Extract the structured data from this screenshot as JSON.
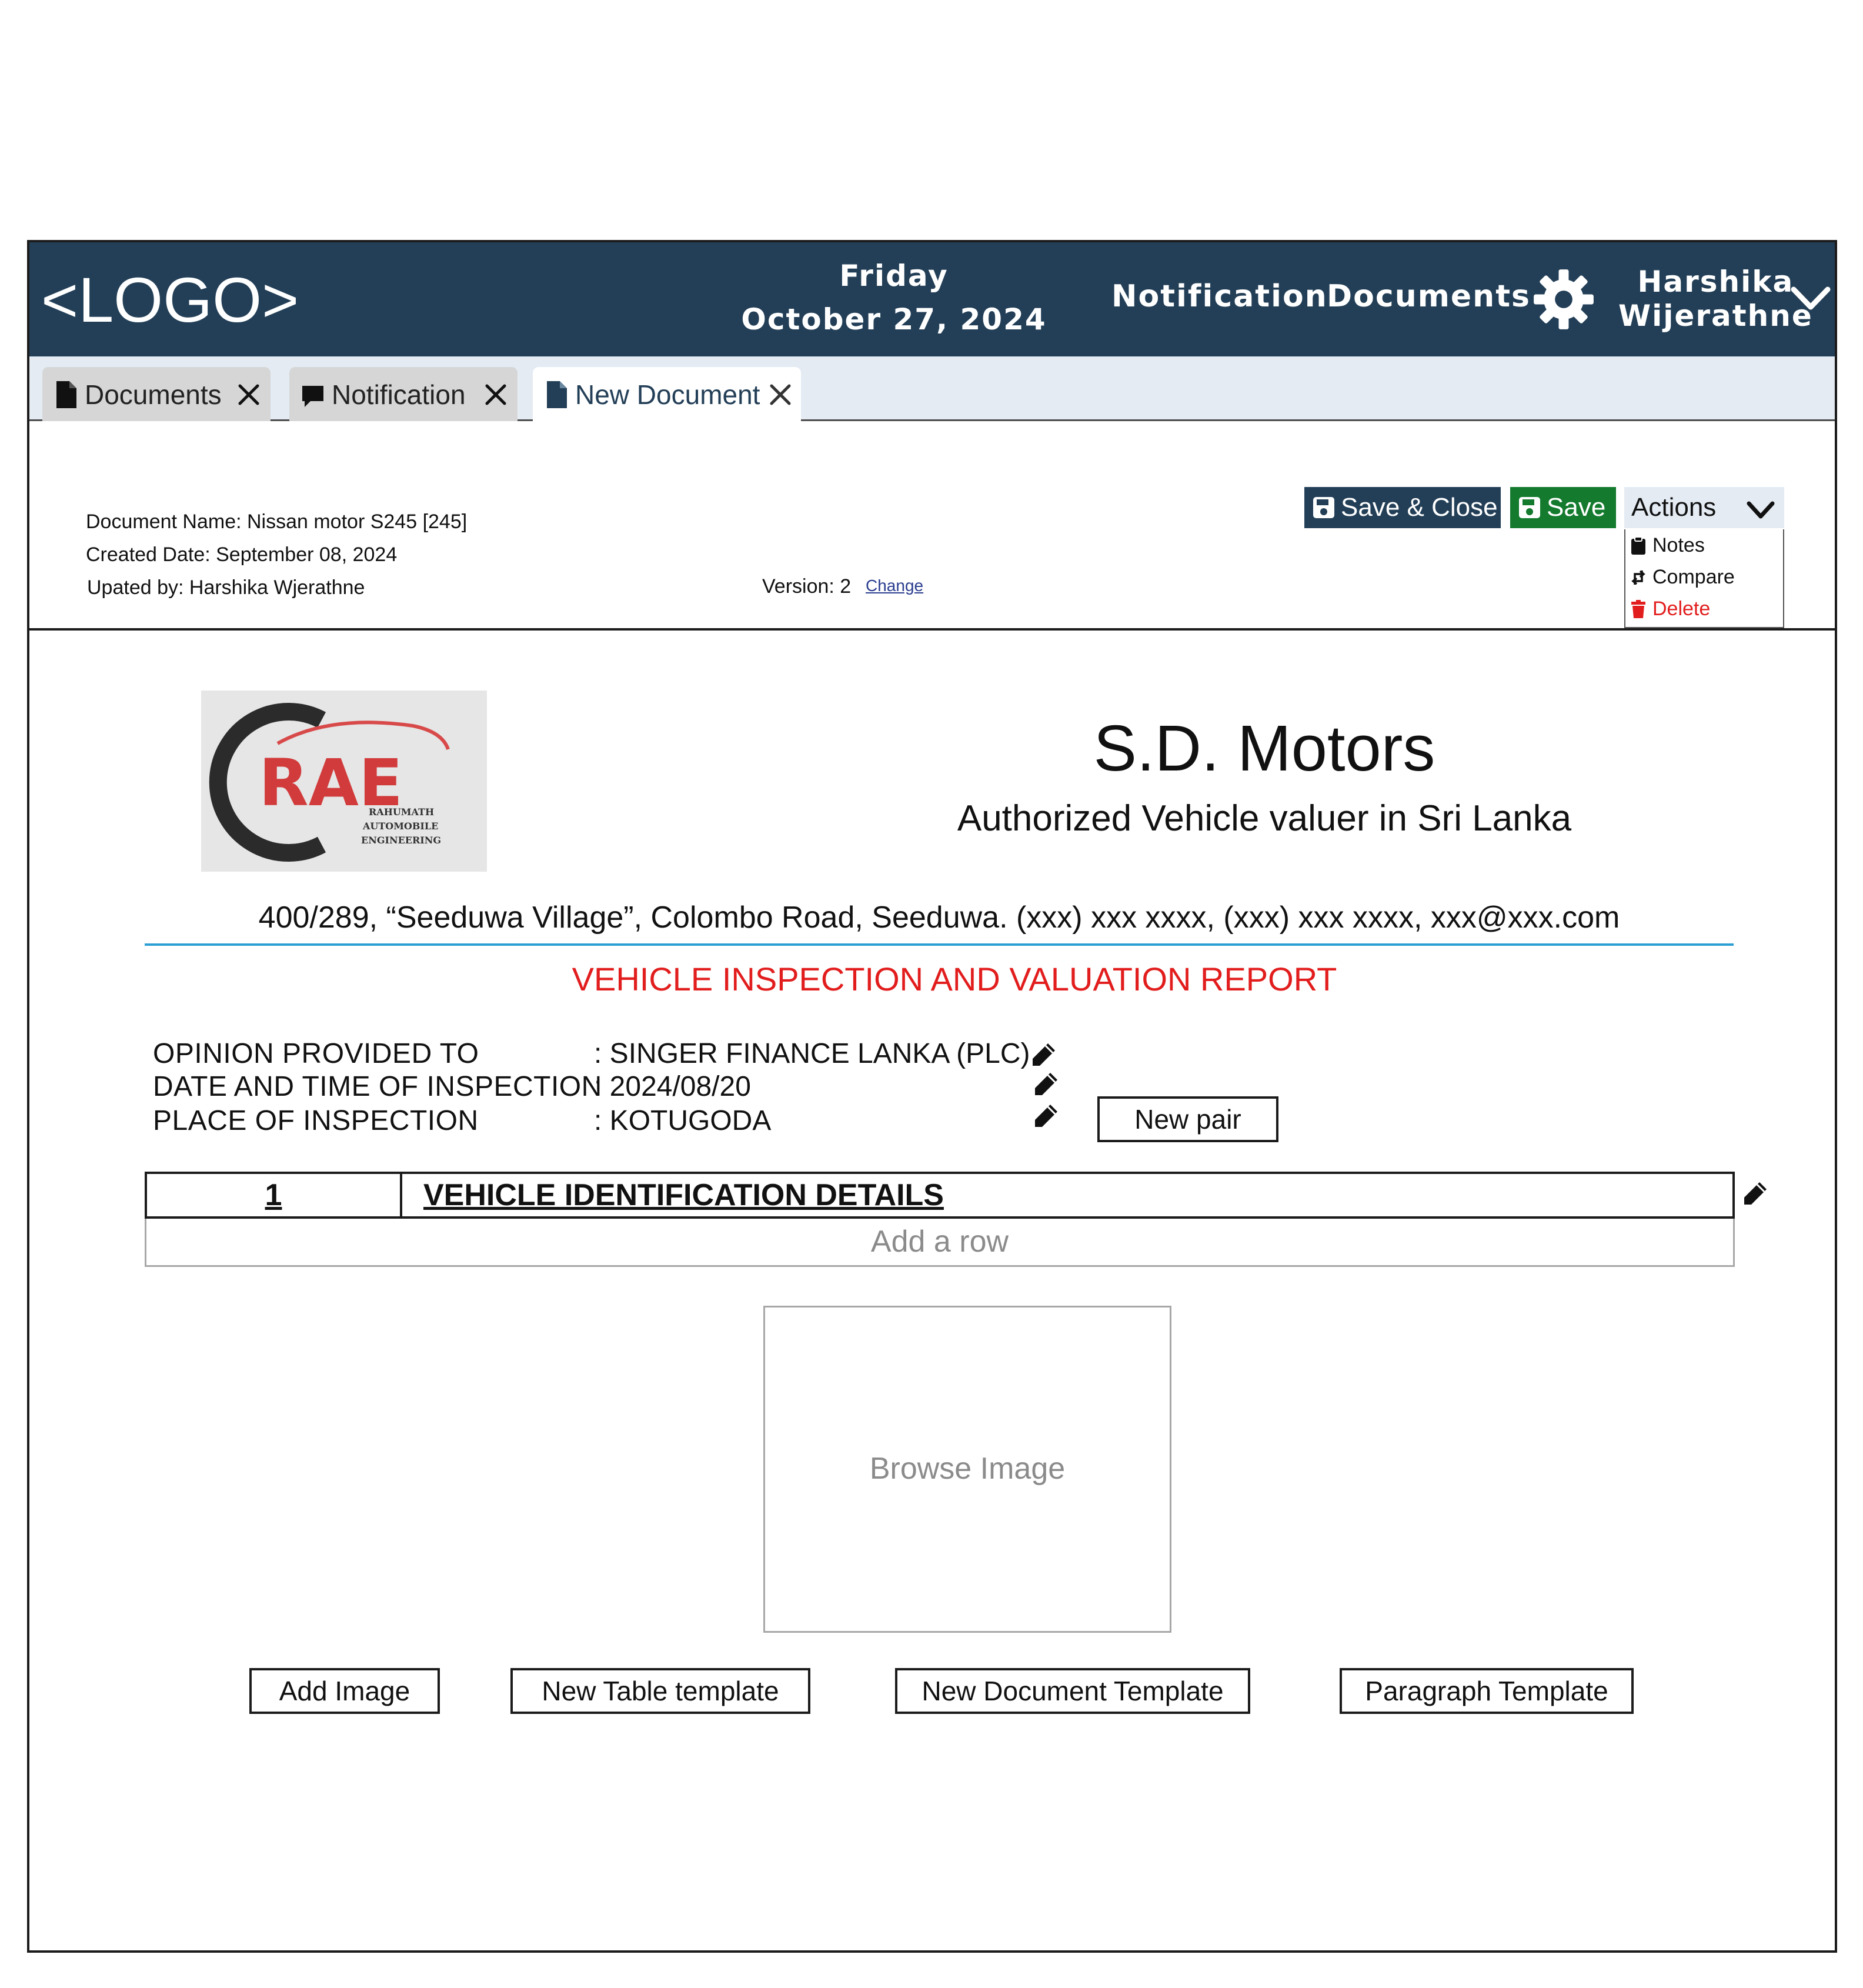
{
  "header": {
    "logo": "<LOGO>",
    "day": "Friday",
    "date": "October 27, 2024",
    "nav": [
      "Notification",
      "Documents"
    ],
    "user_first": "Harshika",
    "user_last": "Wijerathne"
  },
  "tabs": [
    {
      "label": "Documents",
      "icon": "document-icon",
      "active": false
    },
    {
      "label": "Notification",
      "icon": "chat-bubble-icon",
      "active": false
    },
    {
      "label": "New Document",
      "icon": "document-icon",
      "active": true
    }
  ],
  "doc_info": {
    "name": "Document Name: Nissan motor S245 [245]",
    "created": "Created Date: September 08, 2024",
    "updated": "Upated by: Harshika Wjerathne",
    "version": "Version: 2",
    "change_link": "Change"
  },
  "toolbar": {
    "save_close": "Save & Close",
    "save": "Save",
    "actions": "Actions",
    "menu": [
      {
        "label": "Notes",
        "icon": "clipboard-icon",
        "color": "#111111"
      },
      {
        "label": "Compare",
        "icon": "compare-arrows-icon",
        "color": "#111111"
      },
      {
        "label": "Delete",
        "icon": "trash-icon",
        "color": "#e21d1d"
      }
    ]
  },
  "document": {
    "brand_logo_text": "RAE",
    "brand_logo_sub": [
      "RAHUMATH",
      "AUTOMOBILE",
      "ENGINEERING"
    ],
    "company": "S.D. Motors",
    "tagline": "Authorized Vehicle valuer in Sri Lanka",
    "address": "400/289, “Seeduwa Village”, Colombo Road, Seeduwa. (xxx) xxx xxxx, (xxx) xxx xxxx, xxx@xxx.com",
    "report_title": "VEHICLE INSPECTION AND VALUATION REPORT",
    "fields": [
      {
        "label": "OPINION PROVIDED TO",
        "value": ": SINGER FINANCE LANKA (PLC)"
      },
      {
        "label": "DATE AND TIME OF INSPECTION",
        "value": ": 2024/08/20"
      },
      {
        "label": "PLACE OF INSPECTION",
        "value": ": KOTUGODA"
      }
    ],
    "new_pair": "New pair",
    "section_number": "1",
    "section_title": "VEHICLE IDENTIFICATION DETAILS",
    "add_row": "Add a row",
    "browse_image": "Browse Image",
    "bottom_buttons": [
      "Add Image",
      "New Table template",
      "New Document Template",
      "Paragraph Template"
    ]
  },
  "colors": {
    "header_bg": "#233f57",
    "tab_strip": "#e4ebf3",
    "save_green": "#137a2e",
    "report_red": "#e21d1d",
    "rule_blue": "#2b9fd4"
  }
}
